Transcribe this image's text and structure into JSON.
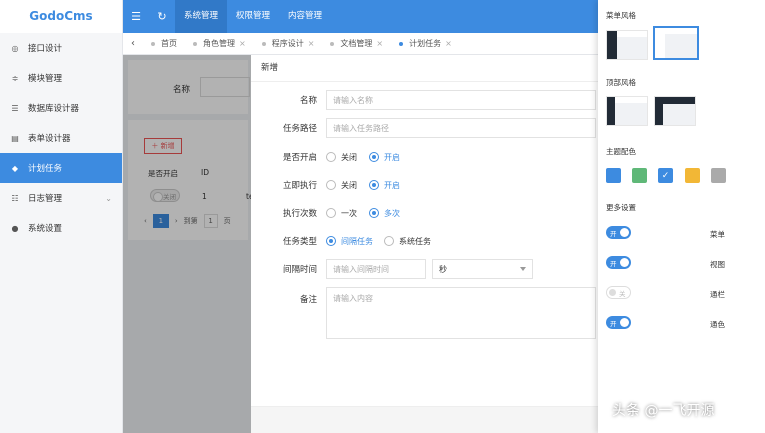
{
  "app": {
    "logo": "GodoCms"
  },
  "sidebar": {
    "items": [
      {
        "label": "接口设计",
        "icon": "globe-icon"
      },
      {
        "label": "模块管理",
        "icon": "sliders-icon"
      },
      {
        "label": "数据库设计器",
        "icon": "database-icon"
      },
      {
        "label": "表单设计器",
        "icon": "form-icon"
      },
      {
        "label": "计划任务",
        "icon": "diamond-icon",
        "active": true
      },
      {
        "label": "日志管理",
        "icon": "list-icon"
      },
      {
        "label": "系统设置",
        "icon": "compass-icon"
      }
    ]
  },
  "header": {
    "tabs": [
      "系统管理",
      "权限管理",
      "内容管理"
    ]
  },
  "page_tabs": [
    {
      "label": "首页"
    },
    {
      "label": "角色管理"
    },
    {
      "label": "程序设计"
    },
    {
      "label": "文档管理"
    },
    {
      "label": "计划任务",
      "active": true
    }
  ],
  "background": {
    "search_label": "名称",
    "add_button": "新增",
    "columns": [
      "是否开启",
      "ID"
    ],
    "row": {
      "switch_text": "关闭",
      "id": "1",
      "extra": "te"
    },
    "pager": {
      "page": "1",
      "goto": "到第",
      "goto_page": "1",
      "page_unit": "页"
    }
  },
  "form": {
    "title": "新增",
    "fields": {
      "name": {
        "label": "名称",
        "placeholder": "请输入名称"
      },
      "path": {
        "label": "任务路径",
        "placeholder": "请输入任务路径"
      },
      "enabled": {
        "label": "是否开启",
        "options": [
          "关闭",
          "开启"
        ],
        "selected": "开启"
      },
      "run_now": {
        "label": "立即执行",
        "options": [
          "关闭",
          "开启"
        ],
        "selected": "开启"
      },
      "run_count": {
        "label": "执行次数",
        "options": [
          "一次",
          "多次"
        ],
        "selected": "多次"
      },
      "task_type": {
        "label": "任务类型",
        "options": [
          "间隔任务",
          "系统任务"
        ],
        "selected": "间隔任务"
      },
      "interval": {
        "label": "间隔时间",
        "placeholder": "请输入间隔时间",
        "unit": "秒"
      },
      "remark": {
        "label": "备注",
        "placeholder": "请输入内容"
      }
    }
  },
  "settings": {
    "menu_style": "菜单风格",
    "top_style": "顶部风格",
    "theme_color": "主题配色",
    "more": "更多设置",
    "colors": [
      "#3d8be0",
      "#5fb878",
      "#3d8be0",
      "#f2b736",
      "#aaaaaa"
    ],
    "toggles": [
      {
        "text": "开",
        "label": "菜单",
        "on": true
      },
      {
        "text": "开",
        "label": "视图",
        "on": true
      },
      {
        "text": "关",
        "label": "通栏",
        "on": false
      },
      {
        "text": "开",
        "label": "通色",
        "on": true
      }
    ]
  },
  "watermark": "头条 @一飞开源"
}
